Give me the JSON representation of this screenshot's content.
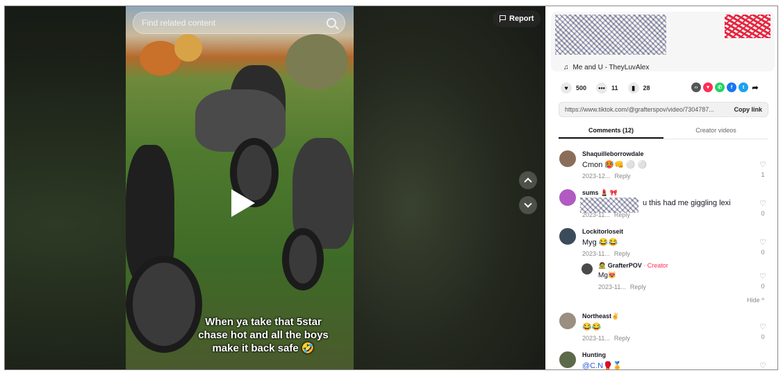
{
  "player": {
    "search_placeholder": "Find related content",
    "report_label": "Report",
    "caption": "When ya take that 5star chase hot and all the boys make it back safe 🤣"
  },
  "author": {
    "music": "Me and U - TheyLuvAlex"
  },
  "stats": {
    "likes": "500",
    "comments": "11",
    "saves": "28"
  },
  "share": {
    "url": "https://www.tiktok.com/@grafterspov/video/7304787...",
    "copy_label": "Copy link"
  },
  "tabs": {
    "comments": "Comments (12)",
    "creator_videos": "Creator videos"
  },
  "comments": [
    {
      "user": "Shaquilleborrowdale",
      "text": "Cmon 🥵👊 ⚪ ⚪",
      "date": "2023-12...",
      "reply": "Reply",
      "likes": "1"
    },
    {
      "user": "sums 💄 🎀",
      "text": "u this had me giggling lexi",
      "date": "2023-11...",
      "reply": "Reply",
      "likes": "0"
    },
    {
      "user": "Lockitorloseit",
      "text": "Myg 😂😂",
      "date": "2023-11...",
      "reply": "Reply",
      "likes": "0"
    },
    {
      "user": "Northeast✌",
      "text": "😂😂",
      "date": "2023-11...",
      "reply": "Reply",
      "likes": "0"
    },
    {
      "user": "Hunting",
      "text": "@C.N🥊🏅",
      "date": "",
      "reply": "",
      "likes": ""
    }
  ],
  "reply": {
    "user": "🧟 GrafterPOV",
    "badge": "· Creator",
    "text": "Mg😻",
    "date": "2023-11...",
    "reply": "Reply",
    "likes": "0"
  },
  "hide_label": "Hide ^",
  "colors": {
    "accent": "#fe2c55",
    "link": "#2b5cd9"
  }
}
